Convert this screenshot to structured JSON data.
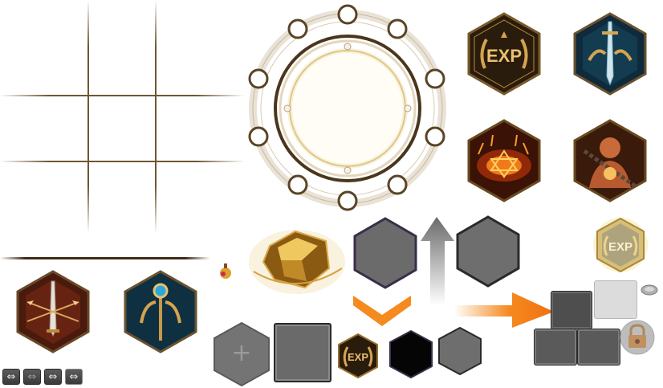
{
  "colors": {
    "gold": "#c9a04a",
    "dark_frame": "#3a2a16",
    "gray_hex": "#6e6e6e",
    "orange_accent": "#f58a1f"
  },
  "icons": {
    "exp_badge_text": "EXP",
    "exp_small_text": "EXP",
    "exp_glow_text": "EXP"
  },
  "controls": {
    "plus_symbol": "+",
    "arrow_buttons": [
      "⇔",
      "⇔",
      "⇔",
      "⇔"
    ]
  }
}
